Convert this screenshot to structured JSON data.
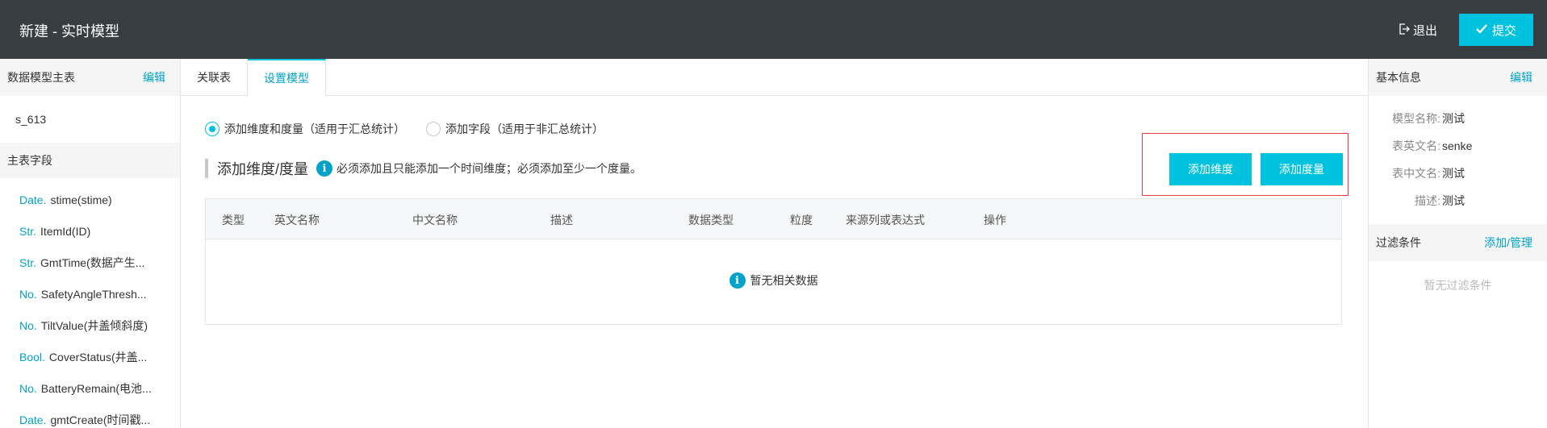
{
  "header": {
    "title": "新建 - 实时模型",
    "logout_label": "退出",
    "submit_label": "提交"
  },
  "left_panel": {
    "main_table_label": "数据模型主表",
    "edit_label": "编辑",
    "table_name": "s_613",
    "fields_label": "主表字段",
    "fields": [
      {
        "type": "Date.",
        "name": "stime(stime)"
      },
      {
        "type": "Str.",
        "name": "ItemId(ID)"
      },
      {
        "type": "Str.",
        "name": "GmtTime(数据产生..."
      },
      {
        "type": "No.",
        "name": "SafetyAngleThresh..."
      },
      {
        "type": "No.",
        "name": "TiltValue(井盖倾斜度)"
      },
      {
        "type": "Bool.",
        "name": "CoverStatus(井盖..."
      },
      {
        "type": "No.",
        "name": "BatteryRemain(电池..."
      },
      {
        "type": "Date.",
        "name": "gmtCreate(时间戳..."
      }
    ]
  },
  "tabs": [
    {
      "label": "关联表",
      "active": false
    },
    {
      "label": "设置模型",
      "active": true
    }
  ],
  "model": {
    "radio_options": [
      {
        "label": "添加维度和度量（适用于汇总统计）",
        "checked": true
      },
      {
        "label": "添加字段（适用于非汇总统计）",
        "checked": false
      }
    ],
    "section_title": "添加维度/度量",
    "section_note": "必须添加且只能添加一个时间维度；必须添加至少一个度量。",
    "add_dimension_label": "添加维度",
    "add_measure_label": "添加度量",
    "columns": [
      "类型",
      "英文名称",
      "中文名称",
      "描述",
      "数据类型",
      "粒度",
      "来源列或表达式",
      "操作"
    ],
    "empty_text": "暂无相关数据"
  },
  "right_panel": {
    "basic_info_label": "基本信息",
    "edit_label": "编辑",
    "info": [
      {
        "key": "模型名称:",
        "value": "测试"
      },
      {
        "key": "表英文名:",
        "value": "senke"
      },
      {
        "key": "表中文名:",
        "value": "测试"
      },
      {
        "key": "描述:",
        "value": "测试"
      }
    ],
    "filter_label": "过滤条件",
    "filter_manage_label": "添加/管理",
    "no_filter_text": "暂无过滤条件"
  },
  "colors": {
    "header_bg": "#373d41",
    "accent": "#00c1de",
    "link": "#00a2ca",
    "highlight_border": "#e83d3d"
  }
}
